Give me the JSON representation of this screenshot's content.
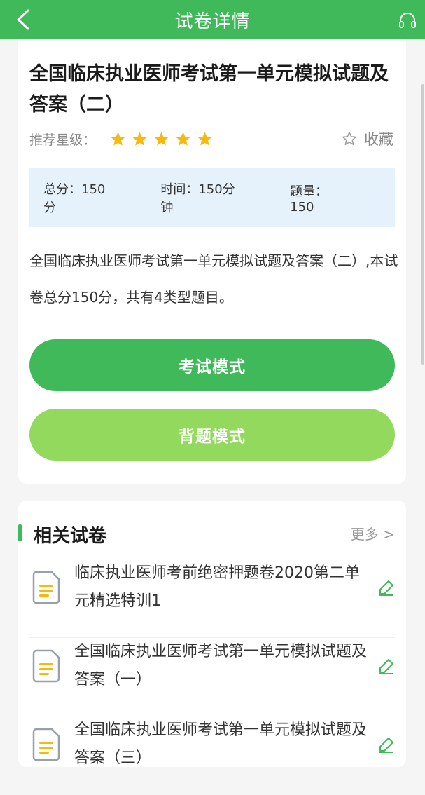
{
  "header": {
    "title": "试卷详情",
    "back_icon": "chevron-left-icon",
    "right_icon": "headset-icon"
  },
  "paper": {
    "title": "全国临床执业医师考试第一单元模拟试题及答案（二）",
    "rating_label": "推荐星级：",
    "stars": 5,
    "favorite_label": "收藏",
    "info": {
      "score": "总分：150分",
      "time": "时间：150分钟",
      "count": "题量：150"
    },
    "description": "全国临床执业医师考试第一单元模拟试题及答案（二）,本试卷总分150分，共有4类型题目。"
  },
  "buttons": {
    "exam": "考试模式",
    "recite": "背题模式"
  },
  "related": {
    "title": "相关试卷",
    "more": "更多 >",
    "items": [
      {
        "title": "临床执业医师考前绝密押题卷2020第二单元精选特训1"
      },
      {
        "title": "全国临床执业医师考试第一单元模拟试题及答案（一）"
      },
      {
        "title": "全国临床执业医师考试第一单元模拟试题及答案（三）"
      }
    ]
  },
  "colors": {
    "primary": "#3fb95a",
    "secondary": "#93d95e",
    "star": "#f5b90f",
    "info_bg": "#e6f2fb"
  }
}
